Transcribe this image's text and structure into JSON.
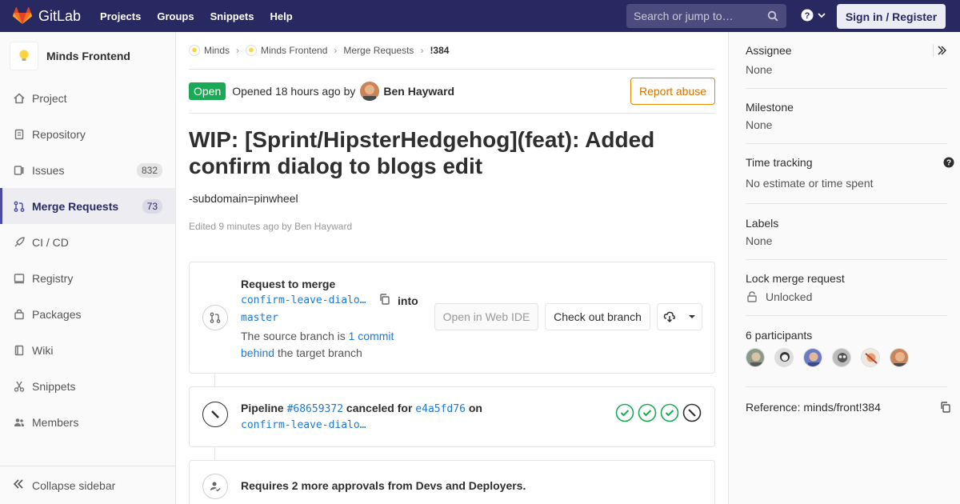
{
  "navbar": {
    "brand": "GitLab",
    "links": [
      "Projects",
      "Groups",
      "Snippets",
      "Help"
    ],
    "search_placeholder": "Search or jump to…",
    "signin": "Sign in / Register"
  },
  "sidebar": {
    "project_name": "Minds Frontend",
    "items": [
      {
        "label": "Project",
        "icon": "home-icon"
      },
      {
        "label": "Repository",
        "icon": "doc-icon"
      },
      {
        "label": "Issues",
        "icon": "issues-icon",
        "badge": "832"
      },
      {
        "label": "Merge Requests",
        "icon": "merge-request-icon",
        "badge": "73",
        "active": true
      },
      {
        "label": "CI / CD",
        "icon": "rocket-icon"
      },
      {
        "label": "Registry",
        "icon": "container-icon"
      },
      {
        "label": "Packages",
        "icon": "package-icon"
      },
      {
        "label": "Wiki",
        "icon": "book-icon"
      },
      {
        "label": "Snippets",
        "icon": "scissors-icon"
      },
      {
        "label": "Members",
        "icon": "users-icon"
      }
    ],
    "collapse_label": "Collapse sidebar"
  },
  "breadcrumbs": [
    "Minds",
    "Minds Frontend",
    "Merge Requests",
    "!384"
  ],
  "status": {
    "badge": "Open",
    "opened_text": "Opened 18 hours ago by",
    "author": "Ben Hayward",
    "report_label": "Report abuse"
  },
  "mr": {
    "title": "WIP: [Sprint/HipsterHedgehog](feat): Added confirm dialog to blogs edit",
    "description": "-subdomain=pinwheel",
    "edited": "Edited 9 minutes ago by Ben Hayward"
  },
  "merge_widget": {
    "title": "Request to merge",
    "source_branch": "confirm-leave-dialo…",
    "into": "into",
    "target_branch": "master",
    "note_prefix": "The source branch is",
    "note_link": "1 commit behind",
    "note_suffix": "the target branch",
    "btn_web_ide": "Open in Web IDE",
    "btn_checkout": "Check out branch"
  },
  "pipeline": {
    "label": "Pipeline",
    "id": "#68659372",
    "status_text": "canceled for",
    "commit": "e4a5fd76",
    "on": "on",
    "branch": "confirm-leave-dialo…",
    "stages": [
      "passed",
      "passed",
      "passed",
      "canceled"
    ]
  },
  "approvals": {
    "text": "Requires 2 more approvals from Devs and Deployers."
  },
  "right_sidebar": {
    "assignee_label": "Assignee",
    "assignee_value": "None",
    "milestone_label": "Milestone",
    "milestone_value": "None",
    "time_label": "Time tracking",
    "time_value": "No estimate or time spent",
    "labels_label": "Labels",
    "labels_value": "None",
    "lock_label": "Lock merge request",
    "lock_value": "Unlocked",
    "participants_label": "6 participants",
    "reference": "Reference: minds/front!384"
  },
  "colors": {
    "navbar": "#292961",
    "open_badge": "#1aaa55",
    "link": "#1f78d1",
    "report": "#d57200",
    "stage_passed": "#1aaa55"
  }
}
